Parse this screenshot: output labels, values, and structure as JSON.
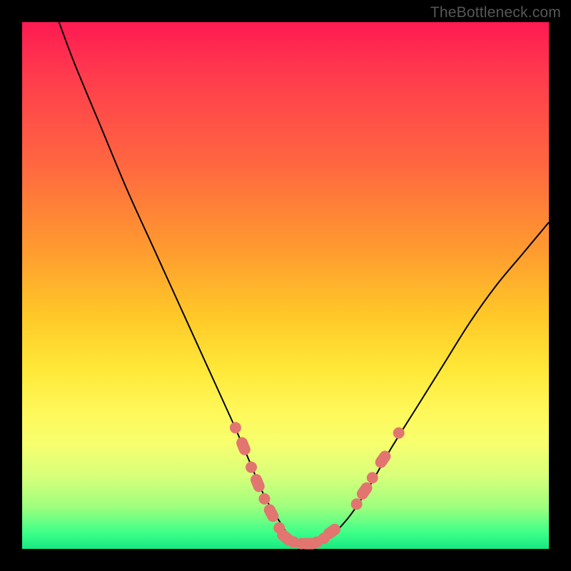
{
  "watermark": "TheBottleneck.com",
  "chart_data": {
    "type": "line",
    "title": "",
    "xlabel": "",
    "ylabel": "",
    "xlim": [
      0,
      100
    ],
    "ylim": [
      0,
      100
    ],
    "grid": false,
    "series": [
      {
        "name": "bottleneck-curve",
        "color": "#000000",
        "x": [
          7,
          10,
          15,
          20,
          25,
          30,
          35,
          40,
          43,
          46,
          49,
          51,
          53,
          55,
          58,
          62,
          66,
          70,
          75,
          80,
          85,
          90,
          95,
          100
        ],
        "y": [
          100,
          92,
          80,
          68,
          57,
          46,
          35,
          24,
          17,
          10,
          5,
          2,
          1,
          1,
          2,
          6,
          12,
          19,
          27,
          35,
          43,
          50,
          56,
          62
        ]
      }
    ],
    "markers": {
      "name": "highlight-dots",
      "color": "#e2756f",
      "points": [
        {
          "x": 40.5,
          "y": 23,
          "shape": "dot"
        },
        {
          "x": 42.0,
          "y": 19.5,
          "shape": "pill",
          "angle": 68
        },
        {
          "x": 43.5,
          "y": 15.5,
          "shape": "dot"
        },
        {
          "x": 44.7,
          "y": 12.5,
          "shape": "pill",
          "angle": 68
        },
        {
          "x": 46.0,
          "y": 9.5,
          "shape": "dot"
        },
        {
          "x": 47.3,
          "y": 6.8,
          "shape": "pill",
          "angle": 62
        },
        {
          "x": 48.8,
          "y": 4.0,
          "shape": "dot"
        },
        {
          "x": 50.0,
          "y": 2.2,
          "shape": "pill",
          "angle": 40
        },
        {
          "x": 51.5,
          "y": 1.3,
          "shape": "dot"
        },
        {
          "x": 53.0,
          "y": 1.0,
          "shape": "dot"
        },
        {
          "x": 54.5,
          "y": 1.0,
          "shape": "pill",
          "angle": 0
        },
        {
          "x": 56.0,
          "y": 1.3,
          "shape": "dot"
        },
        {
          "x": 57.3,
          "y": 2.0,
          "shape": "dot"
        },
        {
          "x": 58.8,
          "y": 3.3,
          "shape": "pill",
          "angle": -35
        },
        {
          "x": 63.5,
          "y": 8.5,
          "shape": "dot"
        },
        {
          "x": 65.0,
          "y": 11,
          "shape": "pill",
          "angle": -55
        },
        {
          "x": 66.5,
          "y": 13.5,
          "shape": "dot"
        },
        {
          "x": 68.5,
          "y": 17,
          "shape": "pill",
          "angle": -55
        },
        {
          "x": 71.5,
          "y": 22,
          "shape": "dot"
        }
      ]
    }
  }
}
